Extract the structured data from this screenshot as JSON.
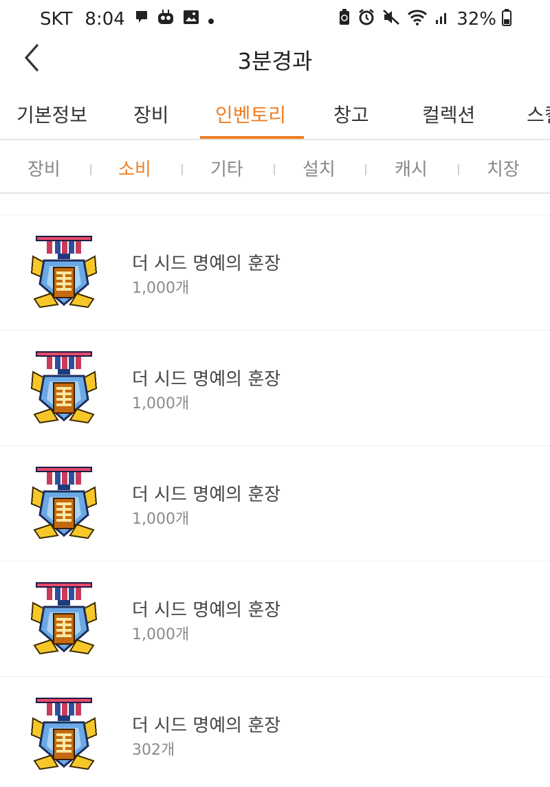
{
  "status_bar": {
    "carrier": "SKT",
    "time": "8:04",
    "battery": "32%",
    "left_icons": [
      "message-icon",
      "bot-icon",
      "gallery-icon",
      "dot-icon"
    ],
    "right_icons": [
      "battery-saver-icon",
      "alarm-icon",
      "mute-icon",
      "wifi-icon",
      "signal-icon",
      "battery-icon"
    ]
  },
  "header": {
    "title": "3분경과"
  },
  "tabs": [
    {
      "label": "기본정보",
      "active": false
    },
    {
      "label": "장비",
      "active": false
    },
    {
      "label": "인벤토리",
      "active": true
    },
    {
      "label": "창고",
      "active": false
    },
    {
      "label": "컬렉션",
      "active": false
    },
    {
      "label": "스킬",
      "active": false
    }
  ],
  "subtabs": [
    {
      "label": "장비",
      "active": false
    },
    {
      "label": "소비",
      "active": true
    },
    {
      "label": "기타",
      "active": false
    },
    {
      "label": "설치",
      "active": false
    },
    {
      "label": "캐시",
      "active": false
    },
    {
      "label": "치장",
      "active": false
    }
  ],
  "items": [
    {
      "name": "더 시드 명예의 훈장",
      "count": "1,000개",
      "icon": "medal-icon"
    },
    {
      "name": "더 시드 명예의 훈장",
      "count": "1,000개",
      "icon": "medal-icon"
    },
    {
      "name": "더 시드 명예의 훈장",
      "count": "1,000개",
      "icon": "medal-icon"
    },
    {
      "name": "더 시드 명예의 훈장",
      "count": "1,000개",
      "icon": "medal-icon"
    },
    {
      "name": "더 시드 명예의 훈장",
      "count": "302개",
      "icon": "medal-icon"
    }
  ],
  "colors": {
    "accent": "#ef7d22",
    "text": "#222222",
    "muted": "#8a8a8a"
  }
}
